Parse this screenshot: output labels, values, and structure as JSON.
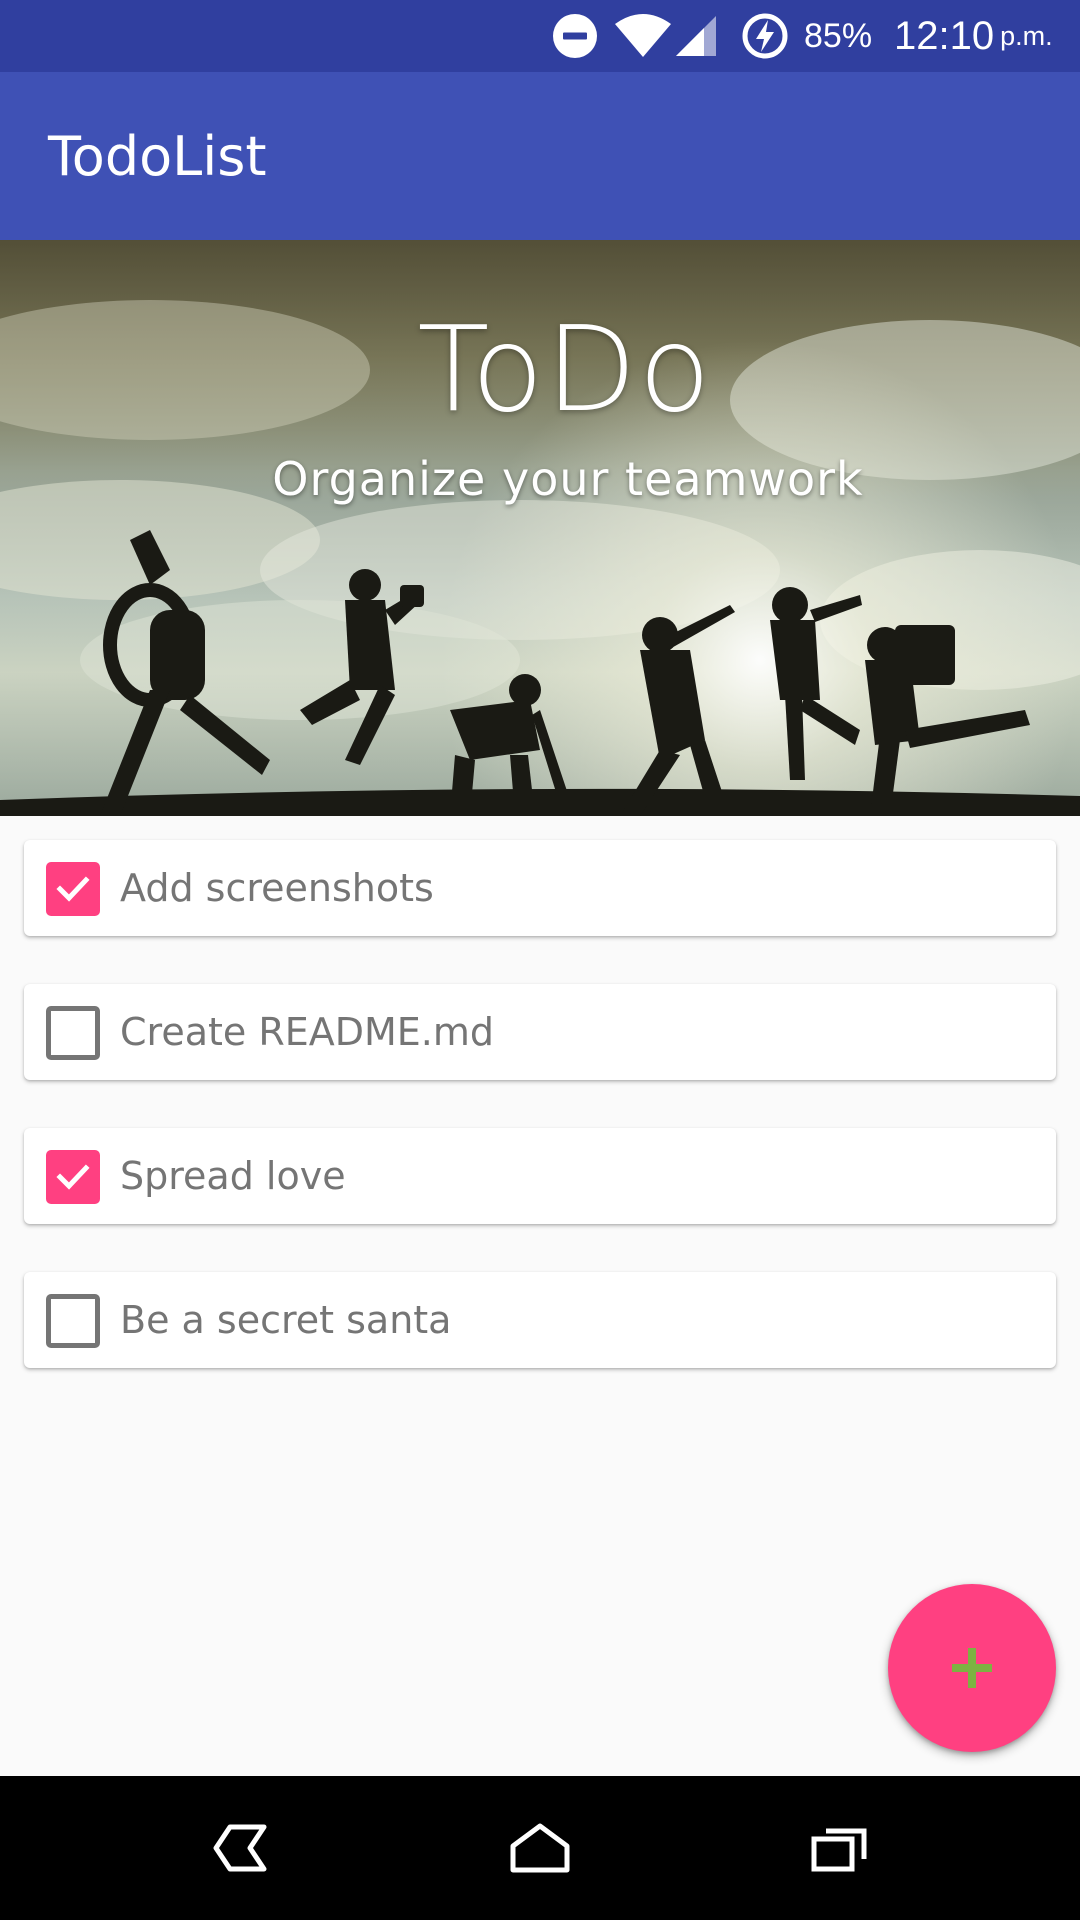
{
  "status_bar": {
    "battery_percent": "85%",
    "time": "12:10",
    "time_suffix": "p.m.",
    "icons": [
      "do-not-disturb-icon",
      "wifi-icon",
      "cell-signal-icon",
      "battery-charging-icon"
    ]
  },
  "app_bar": {
    "title": "TodoList",
    "color": "#3F51B5"
  },
  "banner": {
    "title": "ToDo",
    "subtitle": "Organize your teamwork"
  },
  "tasks": [
    {
      "label": "Add screenshots",
      "checked": true
    },
    {
      "label": "Create README.md",
      "checked": false
    },
    {
      "label": "Spread love",
      "checked": true
    },
    {
      "label": "Be a secret santa",
      "checked": false
    }
  ],
  "fab": {
    "icon": "plus-icon",
    "color": "#FF4081",
    "icon_color": "#7CB342"
  },
  "nav_bar": {
    "buttons": [
      "back-icon",
      "home-icon",
      "recents-icon"
    ]
  }
}
